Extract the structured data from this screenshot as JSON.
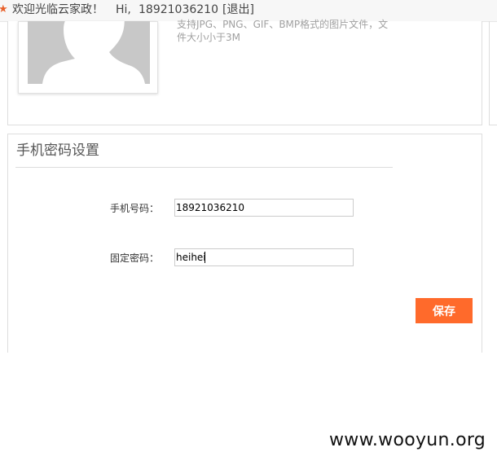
{
  "header": {
    "welcome": "欢迎光临云家政！",
    "greeting": "Hi,",
    "phone": "18921036210",
    "logout": "[退出]"
  },
  "avatar_section": {
    "hint": "支持JPG、PNG、GIF、BMP格式的图片文件，文件大小小于3M"
  },
  "phone_password_section": {
    "title": "手机密码设置",
    "phone_label": "手机号码：",
    "phone_value": "18921036210",
    "password_label": "固定密码：",
    "password_value": "heihei",
    "save_label": "保存"
  },
  "watermark": "www.wooyun.org",
  "colors": {
    "accent": "#ff6a2b",
    "star": "#e8602a",
    "avatar_bg": "#c8c8c8"
  }
}
